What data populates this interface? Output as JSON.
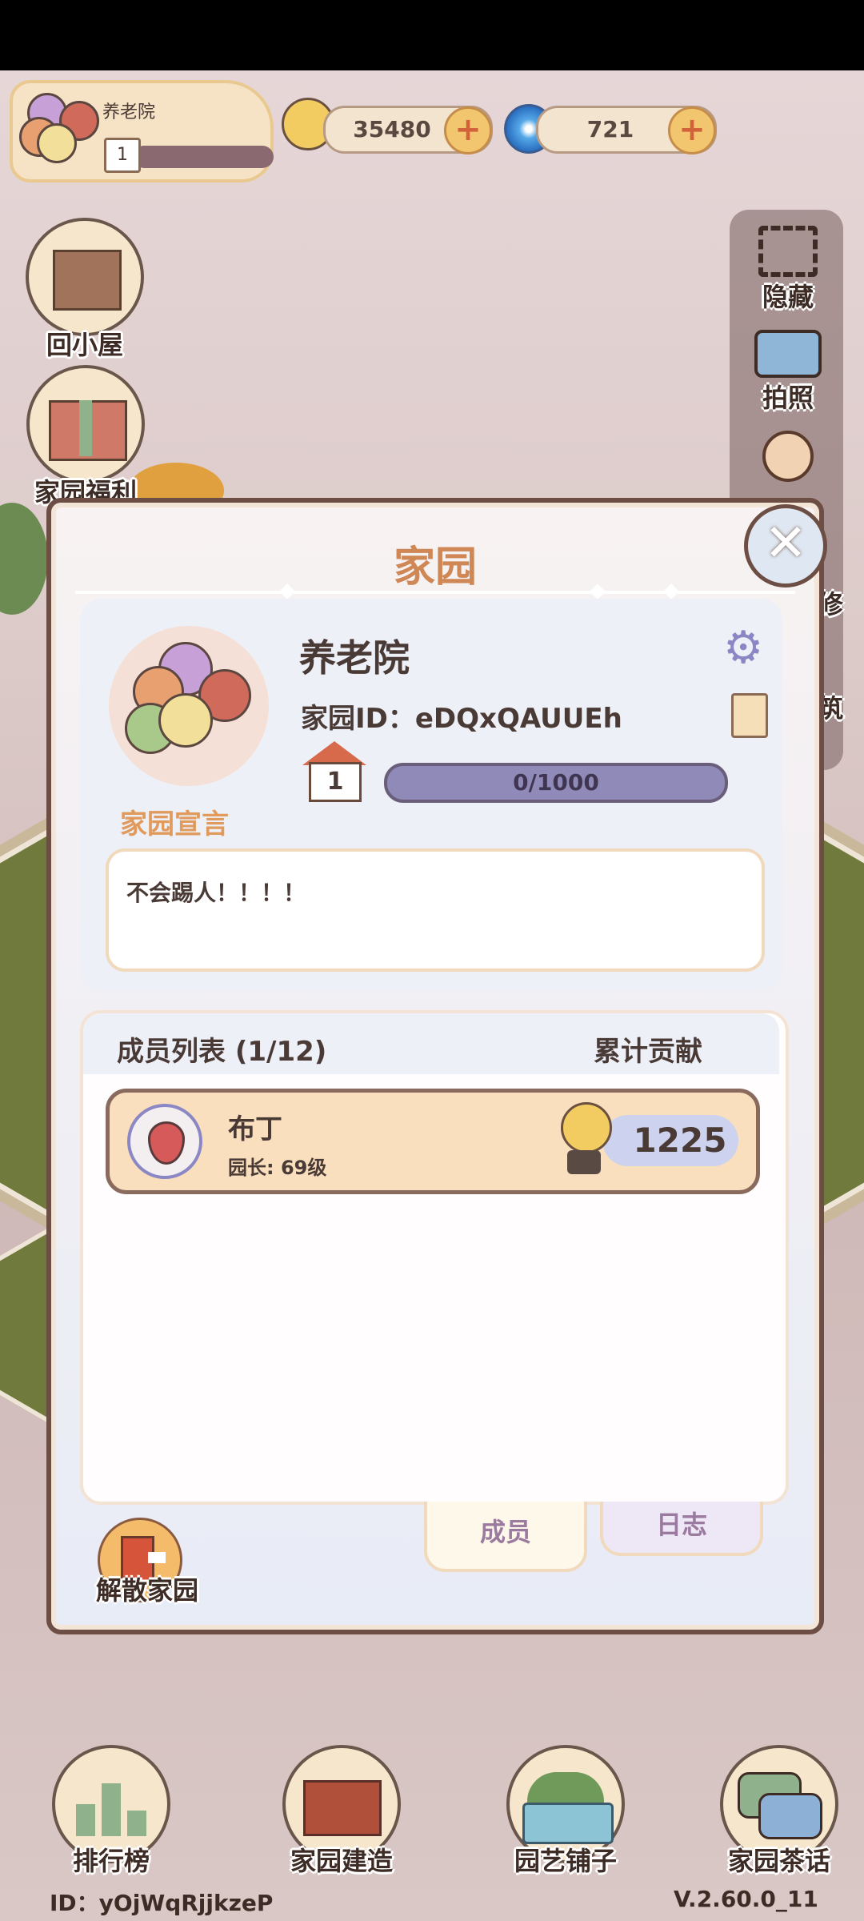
{
  "hud": {
    "garden_name": "养老院",
    "garden_level": "1",
    "snail_currency": "35480",
    "swirl_currency": "721"
  },
  "left_menu": [
    {
      "label": "回小屋",
      "icon": "house-icon"
    },
    {
      "label": "家园福利",
      "icon": "gift-icon"
    }
  ],
  "right_menu": [
    {
      "label": "隐藏",
      "icon": "hide-frame-icon"
    },
    {
      "label": "拍照",
      "icon": "camera-icon"
    },
    {
      "label": "修",
      "icon": "person-icon"
    },
    {
      "label": "筑",
      "icon": "build-icon"
    }
  ],
  "modal": {
    "title": "家园",
    "garden_name": "养老院",
    "garden_id": "家园ID：eDQxQAUUEh",
    "level": "1",
    "progress_text": "0/1000",
    "manifesto_label": "家园宣言",
    "manifesto_text": "不会踢人！！！！",
    "members_header": "成员列表 (1/12)",
    "contribution_header": "累计贡献",
    "members": [
      {
        "name": "布丁",
        "role": "园长: 69级",
        "contribution": "1225"
      }
    ],
    "tabs": [
      "成员",
      "日志"
    ],
    "dissolve_label": "解散家园"
  },
  "bottom_nav": [
    {
      "label": "排行榜",
      "icon": "leaderboard-icon"
    },
    {
      "label": "家园建造",
      "icon": "bricks-trowel-icon"
    },
    {
      "label": "园艺铺子",
      "icon": "planter-icon"
    },
    {
      "label": "家园茶话",
      "icon": "chat-bubbles-icon"
    }
  ],
  "footer": {
    "user_id": "ID：yOjWqRjjkzeP",
    "version": "V.2.60.0_11"
  }
}
